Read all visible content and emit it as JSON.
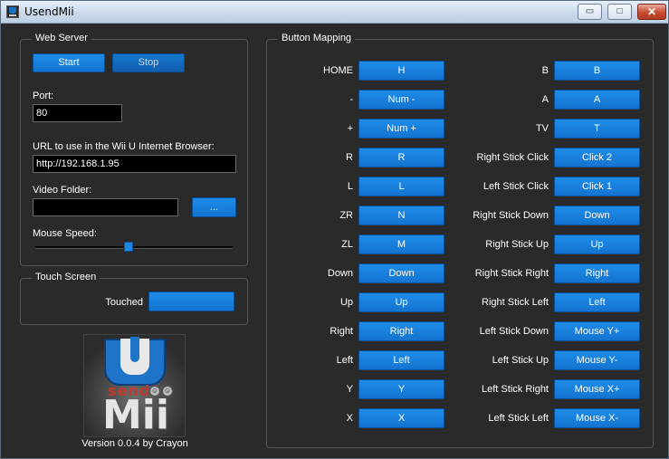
{
  "window": {
    "title": "UsendMii",
    "controls": {
      "minimize": "▭",
      "maximize": "□",
      "close": "✕"
    }
  },
  "web_server": {
    "group_label": "Web Server",
    "start_label": "Start",
    "stop_label": "Stop",
    "port_label": "Port:",
    "port_value": "80",
    "url_label": "URL to use in the Wii U Internet Browser:",
    "url_value": "http://192.168.1.95",
    "video_folder_label": "Video Folder:",
    "video_folder_value": "",
    "browse_label": "...",
    "mouse_speed_label": "Mouse Speed:",
    "mouse_speed_fraction": 0.47
  },
  "touch_screen": {
    "group_label": "Touch Screen",
    "touched_label": "Touched",
    "touched_value": ""
  },
  "logo": {
    "u": "U",
    "send": "send",
    "mii": "Mii"
  },
  "version_text": "Version 0.0.4 by Crayon",
  "button_mapping": {
    "group_label": "Button Mapping",
    "left_column": [
      {
        "label": "HOME",
        "key": "H"
      },
      {
        "label": "-",
        "key": "Num -"
      },
      {
        "label": "+",
        "key": "Num +"
      },
      {
        "label": "R",
        "key": "R"
      },
      {
        "label": "L",
        "key": "L"
      },
      {
        "label": "ZR",
        "key": "N"
      },
      {
        "label": "ZL",
        "key": "M"
      },
      {
        "label": "Down",
        "key": "Down"
      },
      {
        "label": "Up",
        "key": "Up"
      },
      {
        "label": "Right",
        "key": "Right"
      },
      {
        "label": "Left",
        "key": "Left"
      },
      {
        "label": "Y",
        "key": "Y"
      },
      {
        "label": "X",
        "key": "X"
      }
    ],
    "right_column": [
      {
        "label": "B",
        "key": "B"
      },
      {
        "label": "A",
        "key": "A"
      },
      {
        "label": "TV",
        "key": "T"
      },
      {
        "label": "Right Stick Click",
        "key": "Click 2"
      },
      {
        "label": "Left Stick Click",
        "key": "Click 1"
      },
      {
        "label": "Right Stick Down",
        "key": "Down"
      },
      {
        "label": "Right Stick Up",
        "key": "Up"
      },
      {
        "label": "Right Stick Right",
        "key": "Right"
      },
      {
        "label": "Right Stick Left",
        "key": "Left"
      },
      {
        "label": "Left Stick Down",
        "key": "Mouse Y+"
      },
      {
        "label": "Left Stick Up",
        "key": "Mouse Y-"
      },
      {
        "label": "Left Stick Right",
        "key": "Mouse X+"
      },
      {
        "label": "Left Stick Left",
        "key": "Mouse X-"
      }
    ]
  },
  "colors": {
    "background": "#2a2a2a",
    "button_blue": "#1a80dc",
    "text": "#ffffff"
  }
}
